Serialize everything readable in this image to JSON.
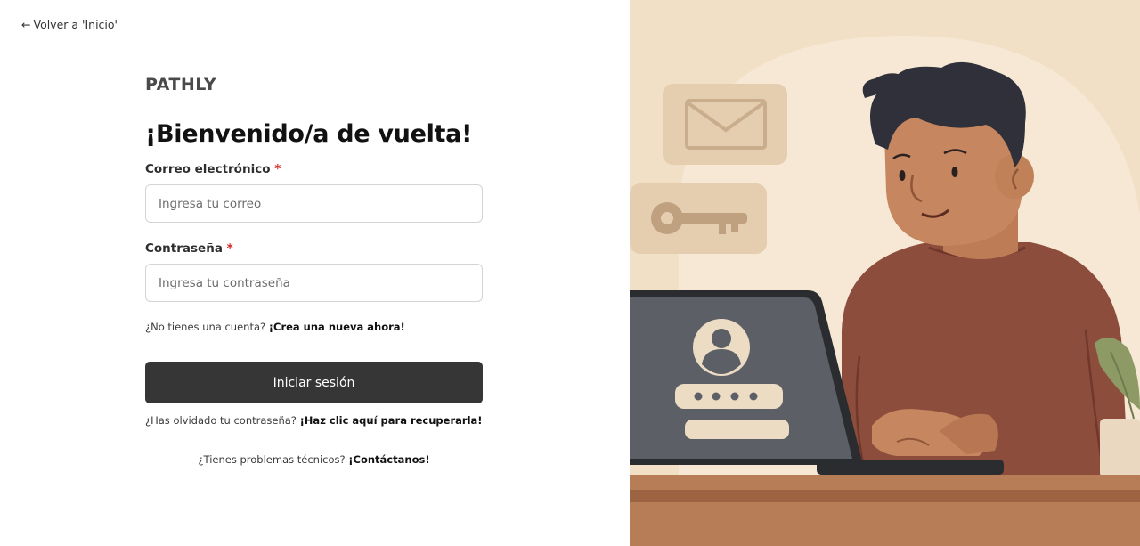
{
  "nav": {
    "back_arrow": "←",
    "back_label": "Volver a 'Inicio'"
  },
  "brand": "PATHLY",
  "title": "¡Bienvenido/a de vuelta!",
  "form": {
    "email_label": "Correo electrónico",
    "email_placeholder": "Ingresa tu correo",
    "password_label": "Contraseña",
    "password_placeholder": "Ingresa tu contraseña",
    "required_mark": "*",
    "submit_label": "Iniciar sesión"
  },
  "links": {
    "signup_prompt": "¿No tienes una cuenta?",
    "signup_link": "¡Crea una nueva ahora!",
    "forgot_prompt": "¿Has olvidado tu contraseña?",
    "forgot_link": "¡Haz clic aquí para recuperarla!",
    "support_prompt": "¿Tienes problemas técnicos?",
    "support_link": "¡Contáctanos!"
  },
  "illustration": {
    "subject": "person-with-laptop-login",
    "icons": [
      "envelope-icon",
      "key-icon",
      "user-avatar-icon",
      "password-dots-icon"
    ]
  },
  "colors": {
    "button_bg": "#363636",
    "required": "#d42a2a",
    "illustration_bg": "#f1dfc6"
  }
}
